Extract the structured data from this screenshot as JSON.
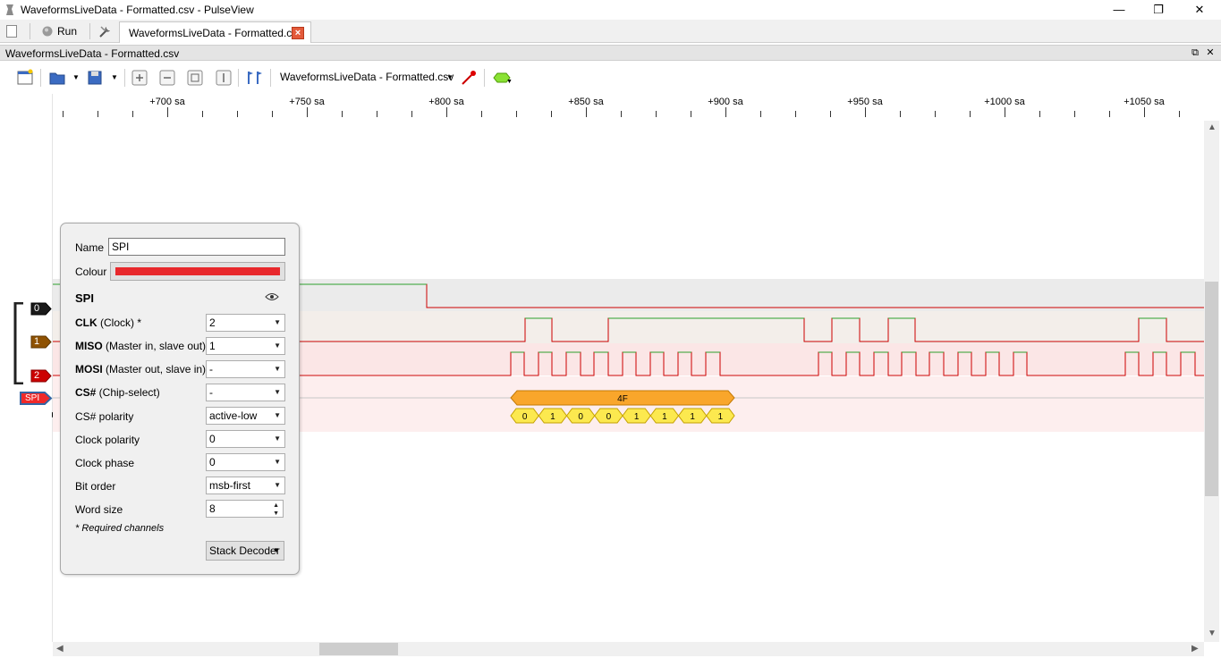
{
  "window": {
    "title": "WaveformsLiveData - Formatted.csv - PulseView",
    "minimize": "—",
    "maximize": "❐",
    "close": "✕"
  },
  "tabbar": {
    "run_label": "Run",
    "session_tab": "WaveformsLiveData - Formatted.csv",
    "close_glyph": "×"
  },
  "dock": {
    "title": "WaveformsLiveData - Formatted.csv",
    "float_glyph": "⧉",
    "close_glyph": "✕"
  },
  "toolbar": {
    "session_selector": "WaveformsLiveData - Formatted.csv"
  },
  "ruler": {
    "labels": [
      "+700 sa",
      "+750 sa",
      "+800 sa",
      "+850 sa",
      "+900 sa",
      "+950 sa",
      "+1000 sa",
      "+1050 sa"
    ]
  },
  "channels": [
    {
      "label": "0",
      "color": "#1a1a1a"
    },
    {
      "label": "1",
      "color": "#8f5202"
    },
    {
      "label": "2",
      "color": "#cc0000"
    }
  ],
  "decoder_label": "SPI",
  "decoder_color": "#ef2929",
  "annotations": {
    "word": "4F",
    "bits": [
      "0",
      "1",
      "0",
      "0",
      "1",
      "1",
      "1",
      "1"
    ]
  },
  "popup": {
    "name_label": "Name",
    "name_value": "SPI",
    "colour_label": "Colour",
    "colour_value": "#e8282c",
    "decoder_title": "SPI",
    "rows": [
      {
        "key": "CLK",
        "desc": " (Clock) *",
        "value": "2"
      },
      {
        "key": "MISO",
        "desc": " (Master in, slave out)",
        "value": "1"
      },
      {
        "key": "MOSI",
        "desc": " (Master out, slave in)",
        "value": "-"
      },
      {
        "key": "CS#",
        "desc": " (Chip-select)",
        "value": "-"
      }
    ],
    "options": [
      {
        "label": "CS# polarity",
        "value": "active-low"
      },
      {
        "label": "Clock polarity",
        "value": "0"
      },
      {
        "label": "Clock phase",
        "value": "0"
      },
      {
        "label": "Bit order",
        "value": "msb-first"
      }
    ],
    "word_size_label": "Word size",
    "word_size_value": "8",
    "required_note": "* Required channels",
    "stack_decoder": "Stack Decoder"
  }
}
